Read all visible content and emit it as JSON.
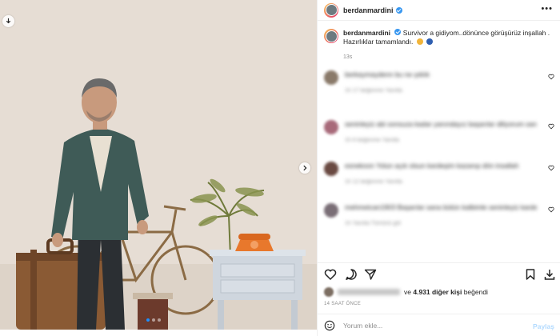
{
  "post": {
    "username": "berdanmardini",
    "caption": "Survivor a gidiyom..dönünce görüşürüz inşallah . Hazırlıklar tamamlandı.",
    "caption_time": "13s",
    "icons": [
      "verified-badge-icon",
      "download-icon",
      "chevron-right-icon",
      "more-options-icon"
    ]
  },
  "comments": [
    {
      "text": "berkaymaydenn bu ne şıklık",
      "meta": "1h   17 beğenme   Yanıtla"
    },
    {
      "text": "seninleyiz abi sonsuza kadar yanındayız başarılar diliyorum sana",
      "meta": "1h   6 beğenme   Yanıtla"
    },
    {
      "text": "esnekoon Yolun açık olsun kardeşim kazanıp dön insallah",
      "meta": "1h   12 beğenme   Yanıtla"
    },
    {
      "text": "mehmetcan1903 Başarılar sana bütün kalbimle seninleyiz kardeşim",
      "meta": "1h   Yanıtla   Tümünü gör"
    }
  ],
  "likes": {
    "prefix": "ve",
    "count_text": "4.931 diğer kişi",
    "suffix": "beğendi"
  },
  "time_ago": "14 SAAT ÖNCE",
  "add_comment": {
    "placeholder": "Yorum ekle...",
    "post_label": "Paylaş"
  },
  "carousel": {
    "total": 3,
    "active": 1
  }
}
